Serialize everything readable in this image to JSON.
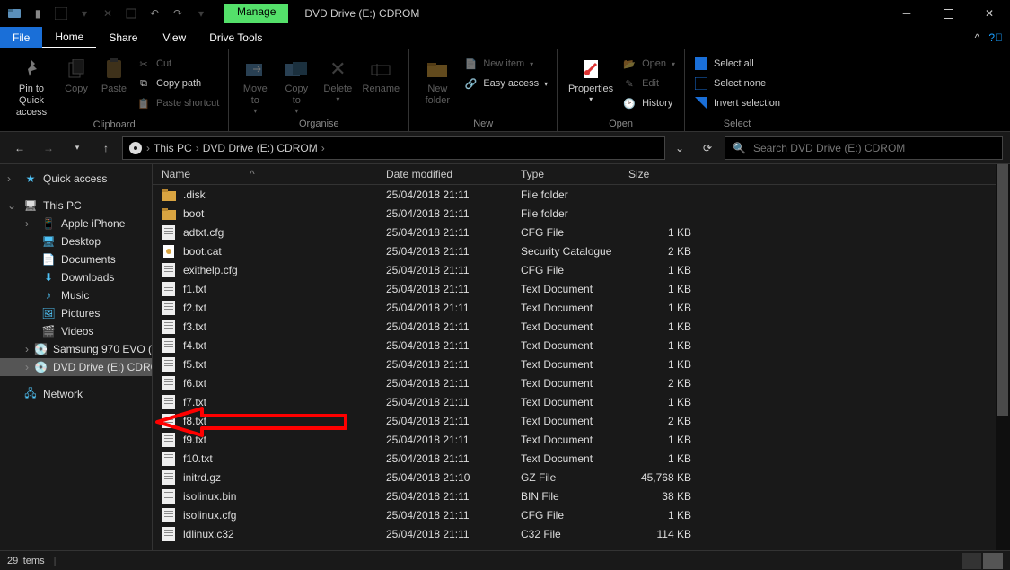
{
  "window": {
    "title": "DVD Drive (E:) CDROM",
    "manage_tab": "Manage"
  },
  "menubar": {
    "file": "File",
    "tabs": [
      "Home",
      "Share",
      "View"
    ],
    "active_tab": 0,
    "drive_tools": "Drive Tools"
  },
  "ribbon": {
    "clipboard": {
      "label": "Clipboard",
      "pin": "Pin to Quick\naccess",
      "copy": "Copy",
      "paste": "Paste",
      "cut": "Cut",
      "copy_path": "Copy path",
      "paste_shortcut": "Paste shortcut"
    },
    "organise": {
      "label": "Organise",
      "move_to": "Move\nto",
      "copy_to": "Copy\nto",
      "delete": "Delete",
      "rename": "Rename"
    },
    "new": {
      "label": "New",
      "new_folder": "New\nfolder",
      "new_item": "New item",
      "easy_access": "Easy access"
    },
    "open": {
      "label": "Open",
      "properties": "Properties",
      "open": "Open",
      "edit": "Edit",
      "history": "History"
    },
    "select": {
      "label": "Select",
      "select_all": "Select all",
      "select_none": "Select none",
      "invert": "Invert selection"
    }
  },
  "breadcrumb": {
    "items": [
      "This PC",
      "DVD Drive (E:) CDROM"
    ]
  },
  "search": {
    "placeholder": "Search DVD Drive (E:) CDROM"
  },
  "nav": {
    "quick_access": "Quick access",
    "this_pc": "This PC",
    "items": [
      "Apple iPhone",
      "Desktop",
      "Documents",
      "Downloads",
      "Music",
      "Pictures",
      "Videos",
      "Samsung 970 EVO (",
      "DVD Drive (E:) CDRO"
    ],
    "network": "Network"
  },
  "columns": {
    "name": "Name",
    "date": "Date modified",
    "type": "Type",
    "size": "Size"
  },
  "files": [
    {
      "icon": "folder",
      "name": ".disk",
      "date": "25/04/2018 21:11",
      "type": "File folder",
      "size": ""
    },
    {
      "icon": "folder",
      "name": "boot",
      "date": "25/04/2018 21:11",
      "type": "File folder",
      "size": ""
    },
    {
      "icon": "cfg",
      "name": "adtxt.cfg",
      "date": "25/04/2018 21:11",
      "type": "CFG File",
      "size": "1 KB"
    },
    {
      "icon": "cat",
      "name": "boot.cat",
      "date": "25/04/2018 21:11",
      "type": "Security Catalogue",
      "size": "2 KB"
    },
    {
      "icon": "cfg",
      "name": "exithelp.cfg",
      "date": "25/04/2018 21:11",
      "type": "CFG File",
      "size": "1 KB"
    },
    {
      "icon": "txt",
      "name": "f1.txt",
      "date": "25/04/2018 21:11",
      "type": "Text Document",
      "size": "1 KB"
    },
    {
      "icon": "txt",
      "name": "f2.txt",
      "date": "25/04/2018 21:11",
      "type": "Text Document",
      "size": "1 KB"
    },
    {
      "icon": "txt",
      "name": "f3.txt",
      "date": "25/04/2018 21:11",
      "type": "Text Document",
      "size": "1 KB"
    },
    {
      "icon": "txt",
      "name": "f4.txt",
      "date": "25/04/2018 21:11",
      "type": "Text Document",
      "size": "1 KB"
    },
    {
      "icon": "txt",
      "name": "f5.txt",
      "date": "25/04/2018 21:11",
      "type": "Text Document",
      "size": "1 KB"
    },
    {
      "icon": "txt",
      "name": "f6.txt",
      "date": "25/04/2018 21:11",
      "type": "Text Document",
      "size": "2 KB"
    },
    {
      "icon": "txt",
      "name": "f7.txt",
      "date": "25/04/2018 21:11",
      "type": "Text Document",
      "size": "1 KB"
    },
    {
      "icon": "txt",
      "name": "f8.txt",
      "date": "25/04/2018 21:11",
      "type": "Text Document",
      "size": "2 KB"
    },
    {
      "icon": "txt",
      "name": "f9.txt",
      "date": "25/04/2018 21:11",
      "type": "Text Document",
      "size": "1 KB"
    },
    {
      "icon": "txt",
      "name": "f10.txt",
      "date": "25/04/2018 21:11",
      "type": "Text Document",
      "size": "1 KB"
    },
    {
      "icon": "file",
      "name": "initrd.gz",
      "date": "25/04/2018 21:10",
      "type": "GZ File",
      "size": "45,768 KB"
    },
    {
      "icon": "file",
      "name": "isolinux.bin",
      "date": "25/04/2018 21:11",
      "type": "BIN File",
      "size": "38 KB"
    },
    {
      "icon": "cfg",
      "name": "isolinux.cfg",
      "date": "25/04/2018 21:11",
      "type": "CFG File",
      "size": "1 KB"
    },
    {
      "icon": "file",
      "name": "ldlinux.c32",
      "date": "25/04/2018 21:11",
      "type": "C32 File",
      "size": "114 KB"
    }
  ],
  "status": {
    "count": "29 items"
  }
}
